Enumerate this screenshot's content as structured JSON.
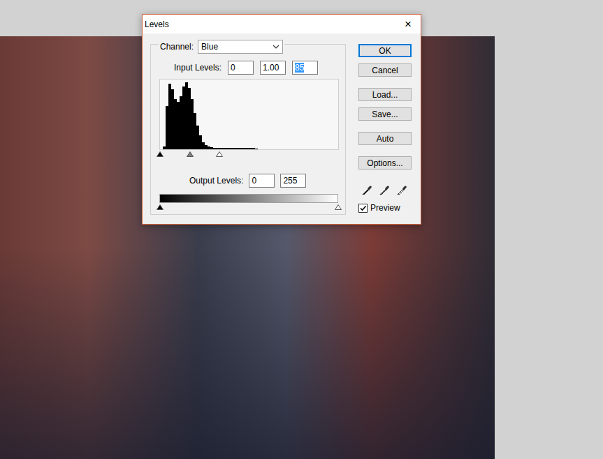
{
  "window": {
    "title": "Levels",
    "close": "×"
  },
  "channel": {
    "label": "Channel:",
    "value": "Blue"
  },
  "input_levels": {
    "label": "Input Levels:",
    "fields": [
      {
        "value": "0",
        "selected": false
      },
      {
        "value": "1.00",
        "selected": false
      },
      {
        "value": "85",
        "selected": true
      }
    ],
    "sliders": [
      {
        "kind": "black",
        "level": 0
      },
      {
        "kind": "gray",
        "level": 0.17
      },
      {
        "kind": "white",
        "level": 0.333
      }
    ]
  },
  "histogram": {
    "values": [
      0,
      4,
      62,
      94,
      86,
      72,
      68,
      76,
      90,
      96,
      88,
      72,
      52,
      34,
      20,
      10,
      6,
      4,
      3,
      2,
      2,
      2,
      2,
      2,
      2,
      2,
      2,
      2,
      2,
      2,
      2,
      2,
      2,
      2,
      1,
      0,
      0,
      0,
      0,
      0,
      0,
      0,
      0,
      0,
      0,
      0,
      0,
      0,
      0,
      0,
      0,
      0,
      0,
      0,
      0,
      0,
      0,
      0,
      0,
      0,
      0,
      0,
      0,
      0
    ]
  },
  "output_levels": {
    "label": "Output Levels:",
    "fields": [
      {
        "value": "0"
      },
      {
        "value": "255"
      }
    ],
    "sliders": [
      {
        "kind": "black",
        "level": 0
      },
      {
        "kind": "white",
        "level": 1
      }
    ]
  },
  "buttons": [
    {
      "label": "OK",
      "default": true
    },
    {
      "label": "Cancel",
      "default": false
    },
    {
      "label": "Load...",
      "default": false
    },
    {
      "label": "Save...",
      "default": false
    },
    {
      "label": "Auto",
      "default": false
    },
    {
      "label": "Options...",
      "default": false
    }
  ],
  "eyedroppers": [
    {
      "kind": "black"
    },
    {
      "kind": "gray"
    },
    {
      "kind": "white"
    }
  ],
  "preview": {
    "label": "Preview",
    "checked": true
  }
}
